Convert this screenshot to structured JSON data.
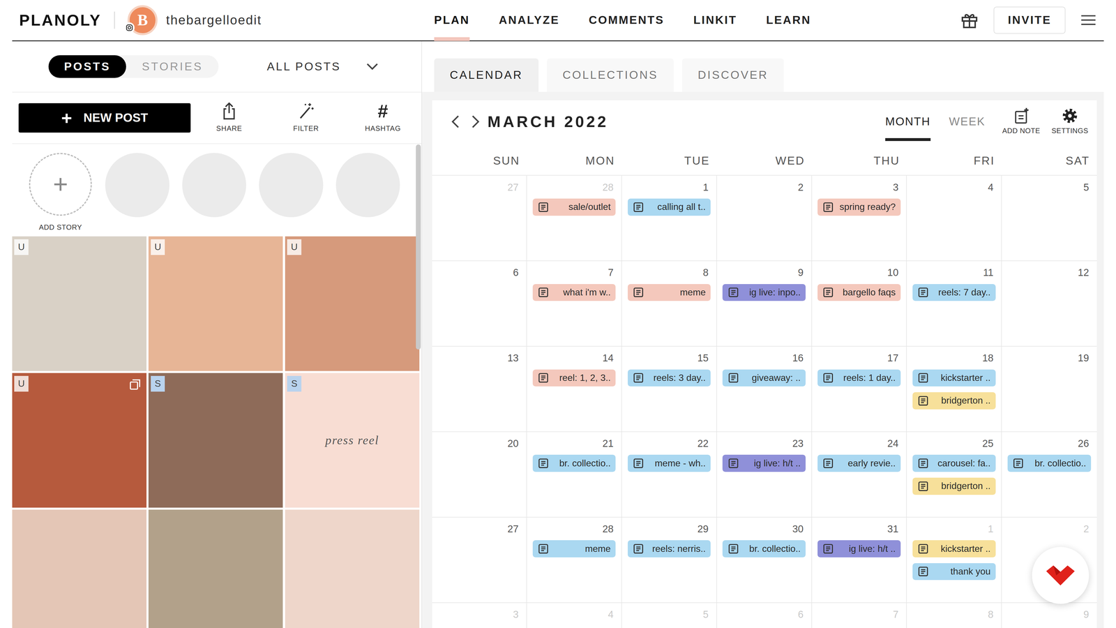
{
  "brand": {
    "logo": "PLANOLY",
    "avatar_letter": "B",
    "account": "thebargelloedit"
  },
  "nav": [
    {
      "label": "PLAN",
      "selected": true
    },
    {
      "label": "ANALYZE",
      "selected": false
    },
    {
      "label": "COMMENTS",
      "selected": false
    },
    {
      "label": "LINKIT",
      "selected": false
    },
    {
      "label": "LEARN",
      "selected": false
    }
  ],
  "invite_button": "INVITE",
  "sidebar": {
    "post_type_tabs": [
      {
        "label": "POSTS",
        "selected": true
      },
      {
        "label": "STORIES",
        "selected": false
      }
    ],
    "filter_dropdown": "ALL POSTS",
    "new_post_button": {
      "icon": "+",
      "label": "NEW POST"
    },
    "tools": [
      {
        "label": "SHARE",
        "kind": "share"
      },
      {
        "label": "FILTER",
        "kind": "wand"
      },
      {
        "label": "HASHTAG",
        "kind": "glyph",
        "icon": "#"
      }
    ],
    "add_story": {
      "icon": "+",
      "label": "ADD STORY"
    },
    "story_slots": [
      {
        "empty": true
      },
      {
        "empty": true
      },
      {
        "empty": true
      },
      {
        "empty": true
      }
    ],
    "posts": [
      {
        "badge": "U",
        "kind": "photo",
        "color": "#d9d1c6",
        "carousel": false
      },
      {
        "badge": "U",
        "kind": "photo",
        "color": "#e7b596",
        "carousel": false
      },
      {
        "badge": "U",
        "kind": "photo",
        "color": "#d69a7c",
        "carousel": false
      },
      {
        "badge": "U",
        "kind": "photo",
        "color": "#b65a3d",
        "carousel": true
      },
      {
        "badge": "S",
        "kind": "photo",
        "color": "#8e6b59",
        "carousel": false
      },
      {
        "badge": "S",
        "kind": "graphic",
        "color": "#f8ddd3",
        "text": "press reel",
        "carousel": false
      },
      {
        "badge": null,
        "kind": "photo",
        "color": "#e4c6b6",
        "carousel": false
      },
      {
        "badge": null,
        "kind": "photo",
        "color": "#b2a18a",
        "carousel": false
      },
      {
        "badge": null,
        "kind": "photo",
        "color": "#eed6ca",
        "carousel": false
      }
    ]
  },
  "calendar": {
    "tabs": [
      {
        "label": "CALENDAR",
        "selected": true
      },
      {
        "label": "COLLECTIONS",
        "selected": false
      },
      {
        "label": "DISCOVER",
        "selected": false
      }
    ],
    "month": "MARCH 2022",
    "views": [
      {
        "label": "MONTH",
        "selected": true
      },
      {
        "label": "WEEK",
        "selected": false
      }
    ],
    "actions": [
      {
        "label": "ADD NOTE",
        "kind": "note"
      },
      {
        "label": "SETTINGS",
        "kind": "gear"
      }
    ],
    "weekdays": [
      "SUN",
      "MON",
      "TUE",
      "WED",
      "THU",
      "FRI",
      "SAT"
    ],
    "weeks": [
      [
        {
          "day": "27",
          "in_month": false,
          "entries": []
        },
        {
          "day": "28",
          "in_month": false,
          "entries": [
            {
              "text": "sale/outlet",
              "color": "#f4c8bc"
            }
          ]
        },
        {
          "day": "1",
          "in_month": true,
          "entries": [
            {
              "text": "calling all t..",
              "color": "#aad8f1"
            }
          ]
        },
        {
          "day": "2",
          "in_month": true,
          "entries": []
        },
        {
          "day": "3",
          "in_month": true,
          "entries": [
            {
              "text": "spring ready?",
              "color": "#f4c8bc"
            }
          ]
        },
        {
          "day": "4",
          "in_month": true,
          "entries": []
        },
        {
          "day": "5",
          "in_month": true,
          "entries": []
        }
      ],
      [
        {
          "day": "6",
          "in_month": true,
          "entries": []
        },
        {
          "day": "7",
          "in_month": true,
          "entries": [
            {
              "text": "what i'm w..",
              "color": "#f4c8bc"
            }
          ]
        },
        {
          "day": "8",
          "in_month": true,
          "entries": [
            {
              "text": "meme",
              "color": "#f4c8bc"
            }
          ]
        },
        {
          "day": "9",
          "in_month": true,
          "entries": [
            {
              "text": "ig live: inpo..",
              "color": "#8f90d9"
            }
          ]
        },
        {
          "day": "10",
          "in_month": true,
          "entries": [
            {
              "text": "bargello faqs",
              "color": "#f4c8bc"
            }
          ]
        },
        {
          "day": "11",
          "in_month": true,
          "entries": [
            {
              "text": "reels: 7 day..",
              "color": "#aad8f1"
            }
          ]
        },
        {
          "day": "12",
          "in_month": true,
          "entries": []
        }
      ],
      [
        {
          "day": "13",
          "in_month": true,
          "entries": []
        },
        {
          "day": "14",
          "in_month": true,
          "entries": [
            {
              "text": "reel: 1, 2, 3..",
              "color": "#f4c8bc"
            }
          ]
        },
        {
          "day": "15",
          "in_month": true,
          "entries": [
            {
              "text": "reels: 3 day..",
              "color": "#aad8f1"
            }
          ]
        },
        {
          "day": "16",
          "in_month": true,
          "entries": [
            {
              "text": "giveaway: ..",
              "color": "#aad8f1"
            }
          ]
        },
        {
          "day": "17",
          "in_month": true,
          "entries": [
            {
              "text": "reels: 1 day..",
              "color": "#aad8f1"
            }
          ]
        },
        {
          "day": "18",
          "in_month": true,
          "entries": [
            {
              "text": "kickstarter ..",
              "color": "#aad8f1"
            },
            {
              "text": "bridgerton ..",
              "color": "#f7e09a"
            }
          ]
        },
        {
          "day": "19",
          "in_month": true,
          "entries": []
        }
      ],
      [
        {
          "day": "20",
          "in_month": true,
          "entries": []
        },
        {
          "day": "21",
          "in_month": true,
          "entries": [
            {
              "text": "br. collectio..",
              "color": "#aad8f1"
            }
          ]
        },
        {
          "day": "22",
          "in_month": true,
          "entries": [
            {
              "text": "meme - wh..",
              "color": "#aad8f1"
            }
          ]
        },
        {
          "day": "23",
          "in_month": true,
          "entries": [
            {
              "text": "ig live: h/t ..",
              "color": "#8f90d9"
            }
          ]
        },
        {
          "day": "24",
          "in_month": true,
          "entries": [
            {
              "text": "early revie..",
              "color": "#aad8f1"
            }
          ]
        },
        {
          "day": "25",
          "in_month": true,
          "entries": [
            {
              "text": "carousel: fa..",
              "color": "#aad8f1"
            },
            {
              "text": "bridgerton ..",
              "color": "#f7e09a"
            }
          ]
        },
        {
          "day": "26",
          "in_month": true,
          "entries": [
            {
              "text": "br. collectio..",
              "color": "#aad8f1"
            }
          ]
        }
      ],
      [
        {
          "day": "27",
          "in_month": true,
          "entries": []
        },
        {
          "day": "28",
          "in_month": true,
          "entries": [
            {
              "text": "meme",
              "color": "#aad8f1"
            }
          ]
        },
        {
          "day": "29",
          "in_month": true,
          "entries": [
            {
              "text": "reels: nerris..",
              "color": "#aad8f1"
            }
          ]
        },
        {
          "day": "30",
          "in_month": true,
          "entries": [
            {
              "text": "br. collectio..",
              "color": "#aad8f1"
            }
          ]
        },
        {
          "day": "31",
          "in_month": true,
          "entries": [
            {
              "text": "ig live: h/t ..",
              "color": "#8f90d9"
            }
          ]
        },
        {
          "day": "1",
          "in_month": false,
          "entries": [
            {
              "text": "kickstarter ..",
              "color": "#f7e09a"
            },
            {
              "text": "thank you",
              "color": "#aad8f1"
            }
          ]
        },
        {
          "day": "2",
          "in_month": false,
          "entries": []
        }
      ],
      [
        {
          "day": "3",
          "in_month": false,
          "entries": []
        },
        {
          "day": "4",
          "in_month": false,
          "entries": []
        },
        {
          "day": "5",
          "in_month": false,
          "entries": []
        },
        {
          "day": "6",
          "in_month": false,
          "entries": []
        },
        {
          "day": "7",
          "in_month": false,
          "entries": []
        },
        {
          "day": "8",
          "in_month": false,
          "entries": []
        },
        {
          "day": "9",
          "in_month": false,
          "entries": []
        }
      ]
    ]
  }
}
